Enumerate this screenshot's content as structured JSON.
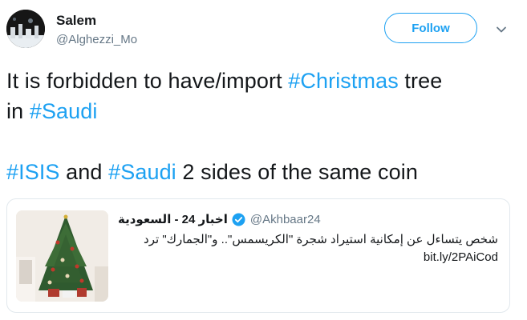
{
  "author": {
    "name": "Salem",
    "handle": "@Alghezzi_Mo"
  },
  "actions": {
    "follow_label": "Follow",
    "menu_icon": "chevron-down-icon"
  },
  "tweet": {
    "line1": {
      "pre": "It is forbidden to have/import ",
      "tag": "#Christmas",
      "post": " tree"
    },
    "line2": {
      "pre": "in ",
      "tag": "#Saudi"
    },
    "line3": {
      "tag1": "#ISIS",
      "mid": " and ",
      "tag2": "#Saudi",
      "post": " 2 sides of the same coin"
    }
  },
  "quoted": {
    "name": "اخبار 24 - السعودية",
    "handle": "@Akhbaar24",
    "verified_icon": "verified-badge-icon",
    "text": "شخص يتساءل عن إمكانية استيراد شجرة \"الكريسمس\".. و\"الجمارك\" ترد",
    "link": "bit.ly/2PAiCod",
    "image": "christmas-tree-photo"
  },
  "colors": {
    "accent": "#1da1f2",
    "text": "#14171a",
    "muted": "#657786",
    "border": "#e1e8ed"
  }
}
